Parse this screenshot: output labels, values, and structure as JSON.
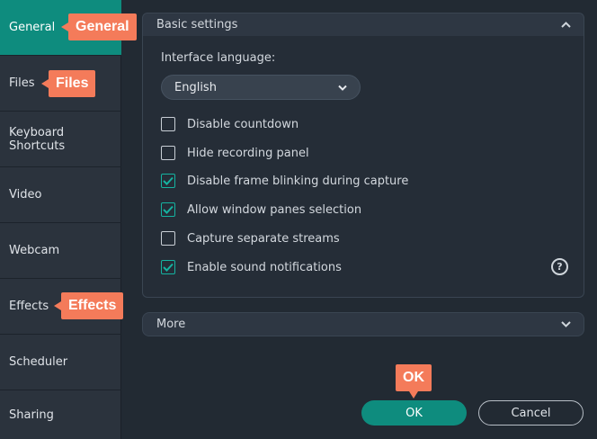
{
  "sidebar": {
    "items": [
      {
        "label": "General",
        "active": true
      },
      {
        "label": "Files"
      },
      {
        "label": "Keyboard\nShortcuts"
      },
      {
        "label": "Video"
      },
      {
        "label": "Webcam"
      },
      {
        "label": "Effects"
      },
      {
        "label": "Scheduler"
      },
      {
        "label": "Sharing"
      }
    ]
  },
  "callouts": {
    "general": "General",
    "files": "Files",
    "effects": "Effects",
    "ok": "OK"
  },
  "basic_settings": {
    "title": "Basic settings",
    "interface_language_label": "Interface language:",
    "language_value": "English",
    "options": [
      {
        "label": "Disable countdown",
        "checked": false
      },
      {
        "label": "Hide recording panel",
        "checked": false
      },
      {
        "label": "Disable frame blinking during capture",
        "checked": true
      },
      {
        "label": "Allow window panes selection",
        "checked": true
      },
      {
        "label": "Capture separate streams",
        "checked": false
      },
      {
        "label": "Enable sound notifications",
        "checked": true
      }
    ],
    "help_glyph": "?"
  },
  "more_section": {
    "title": "More"
  },
  "buttons": {
    "ok": "OK",
    "cancel": "Cancel"
  },
  "colors": {
    "accent": "#0e8c7e",
    "callout": "#f47b5a",
    "checkbox_checked": "#15b3a1"
  },
  "icons": {
    "section_expanded": "chevron-up-icon",
    "section_collapsed": "chevron-down-icon",
    "select": "chevron-down-icon",
    "help": "help-circle-icon",
    "checkbox": "checkmark-icon"
  }
}
